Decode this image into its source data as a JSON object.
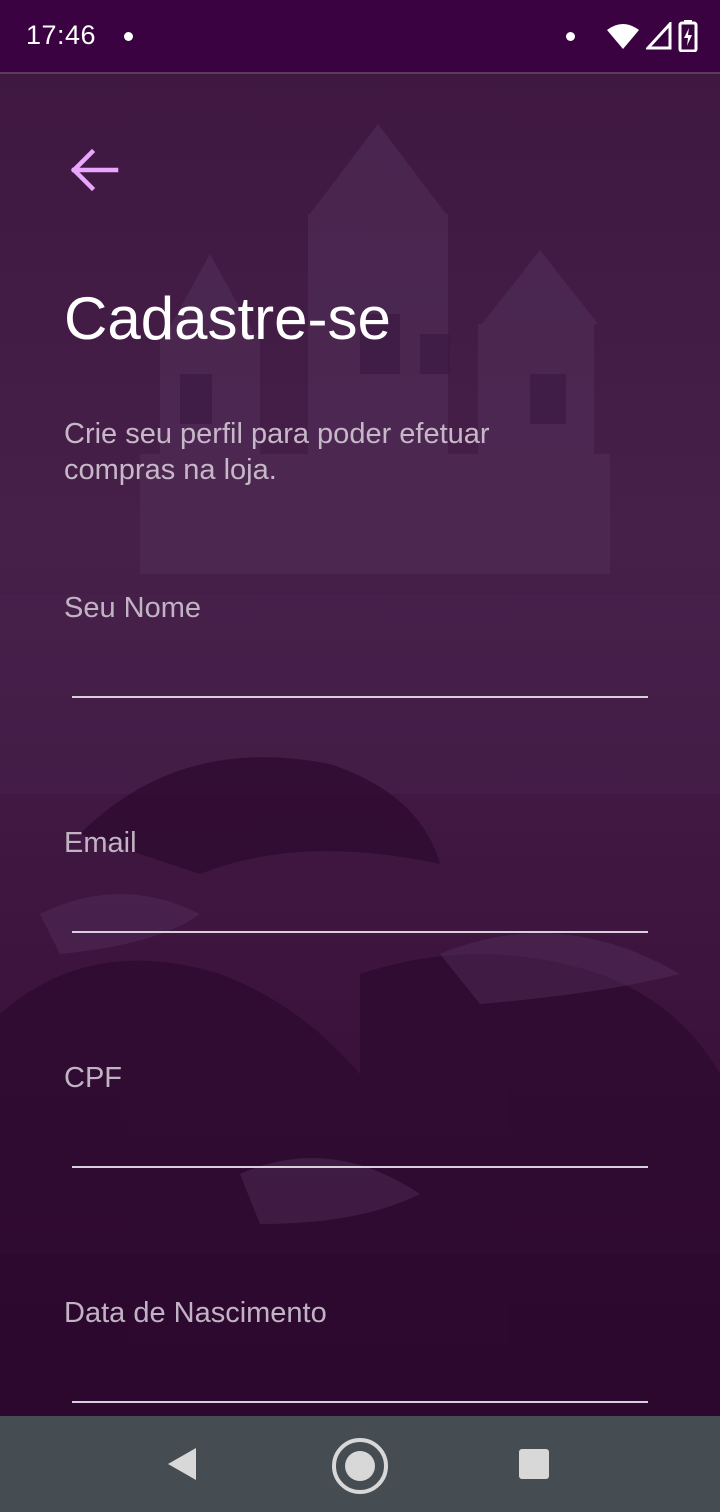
{
  "status_bar": {
    "time": "17:46"
  },
  "header": {
    "back_icon": "arrow-left-icon",
    "title": "Cadastre-se",
    "subtitle": "Crie seu perfil para poder efetuar compras na loja."
  },
  "form": {
    "fields": [
      {
        "label": "Seu Nome",
        "value": ""
      },
      {
        "label": "Email",
        "value": ""
      },
      {
        "label": "CPF",
        "value": ""
      },
      {
        "label": "Data de Nascimento",
        "value": ""
      }
    ]
  },
  "nav_bar": {
    "back": "triangle-back-icon",
    "home": "circle-home-icon",
    "recents": "square-recents-icon"
  },
  "colors": {
    "status_bar": "#3a0240",
    "accent": "#e9a6ff",
    "nav_bar": "#454d53"
  }
}
